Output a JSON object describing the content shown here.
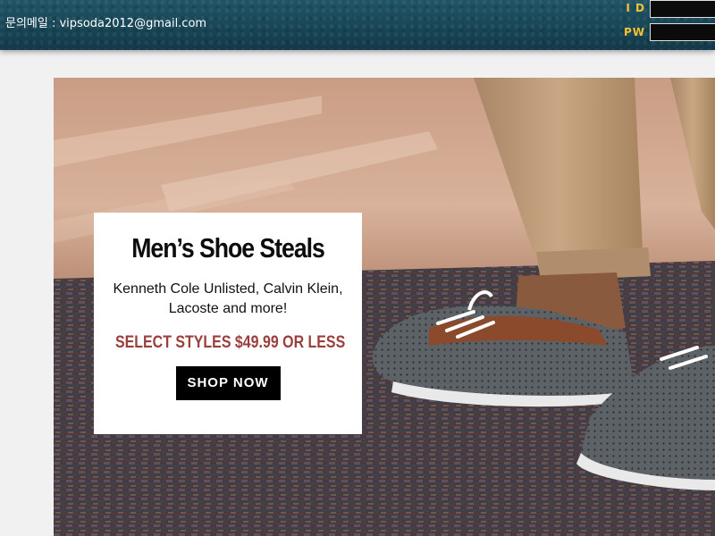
{
  "header": {
    "contact_label": "문의메일 : vipsoda2012@gmail.com",
    "login": {
      "id_label": "I D",
      "pw_label": "PW",
      "id_value": "",
      "pw_value": ""
    }
  },
  "banner": {
    "title": "Men’s Shoe Steals",
    "subtitle": "Kenneth Cole Unlisted, Calvin Klein, Lacoste and more!",
    "price_text": "SELECT STYLES $49.99 OR LESS",
    "cta_label": "SHOP NOW"
  },
  "colors": {
    "header_bg": "#1a4a5b",
    "label_gold": "#f5c233",
    "price_red": "#9b3f3c",
    "cta_bg": "#000000"
  }
}
